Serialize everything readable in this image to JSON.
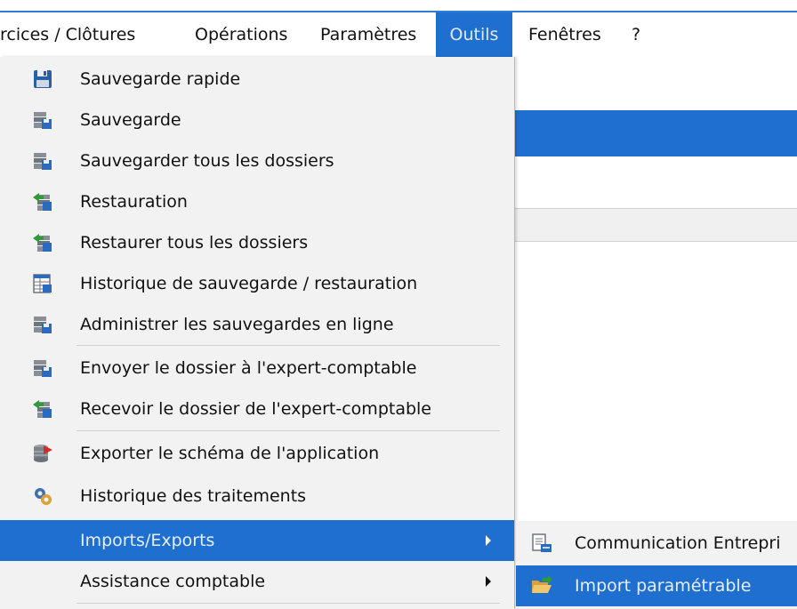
{
  "menubar": {
    "items": [
      {
        "label": "rcices / Clôtures"
      },
      {
        "label": "Opérations"
      },
      {
        "label": "Paramètres"
      },
      {
        "label": "Outils"
      },
      {
        "label": "Fenêtres"
      },
      {
        "label": "?"
      }
    ],
    "active": "Outils"
  },
  "outils_menu": {
    "items": [
      {
        "label": "Sauvegarde rapide",
        "icon": "floppy-disk-icon"
      },
      {
        "label": "Sauvegarde",
        "icon": "server-save-icon"
      },
      {
        "label": "Sauvegarder tous les dossiers",
        "icon": "server-save-icon"
      },
      {
        "label": "Restauration",
        "icon": "server-restore-icon"
      },
      {
        "label": "Restaurer tous les dossiers",
        "icon": "server-restore-icon"
      },
      {
        "label": "Historique de sauvegarde / restauration",
        "icon": "history-table-icon"
      },
      {
        "label": "Administrer les sauvegardes en ligne",
        "icon": "server-save-icon"
      },
      {
        "label": "Envoyer le dossier à l'expert-comptable",
        "icon": "server-save-icon"
      },
      {
        "label": "Recevoir le dossier de l'expert-comptable",
        "icon": "server-restore-icon"
      },
      {
        "label": "Exporter le schéma de l'application",
        "icon": "database-export-icon"
      },
      {
        "label": "Historique des traitements",
        "icon": "gears-icon"
      },
      {
        "label": "Imports/Exports",
        "icon": "",
        "has_submenu": true,
        "highlighted": true
      },
      {
        "label": "Assistance comptable",
        "icon": "",
        "has_submenu": true
      }
    ]
  },
  "imports_submenu": {
    "items": [
      {
        "label": "Communication Entrepri",
        "icon": "document-exchange-icon"
      },
      {
        "label": "Import paramétrable",
        "icon": "open-folder-icon",
        "highlighted": true
      }
    ]
  },
  "colors": {
    "highlight": "#1f6fd0",
    "menu_bg": "#f2f2f2"
  }
}
